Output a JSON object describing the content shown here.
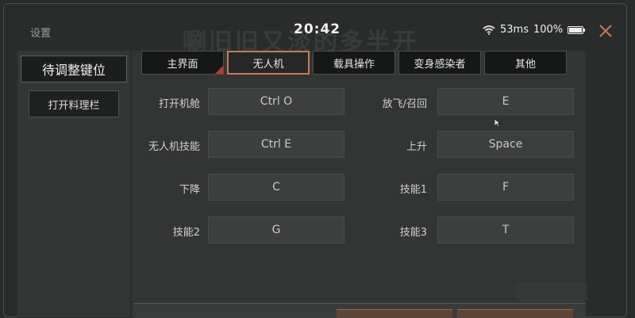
{
  "window": {
    "title": "设置",
    "clock": "20:42"
  },
  "status": {
    "network": "53ms",
    "battery": "100%",
    "battery_level": 1.0,
    "icons": [
      "wifi-icon",
      "battery-icon",
      "close-icon"
    ]
  },
  "background_text": "唰旧旧又淡的多半开",
  "sidebar": {
    "active": "待调整键位",
    "items": [
      {
        "label": "打开料理栏"
      }
    ]
  },
  "tabs": [
    {
      "label": "主界面"
    },
    {
      "label": "无人机",
      "active": true
    },
    {
      "label": "载具操作"
    },
    {
      "label": "变身感染者"
    },
    {
      "label": "其他"
    }
  ],
  "bindings": [
    {
      "label": "打开机舱",
      "key": "Ctrl O"
    },
    {
      "label": "放飞/召回",
      "key": "E"
    },
    {
      "label": "无人机技能",
      "key": "Ctrl E"
    },
    {
      "label": "上升",
      "key": "Space"
    },
    {
      "label": "下降",
      "key": "C"
    },
    {
      "label": "技能1",
      "key": "F"
    },
    {
      "label": "技能2",
      "key": "G"
    },
    {
      "label": "技能3",
      "key": "T"
    }
  ],
  "colors": {
    "accent": "#c87a55",
    "corner_mark": "#c0392b",
    "background": "#2a2c2b"
  }
}
